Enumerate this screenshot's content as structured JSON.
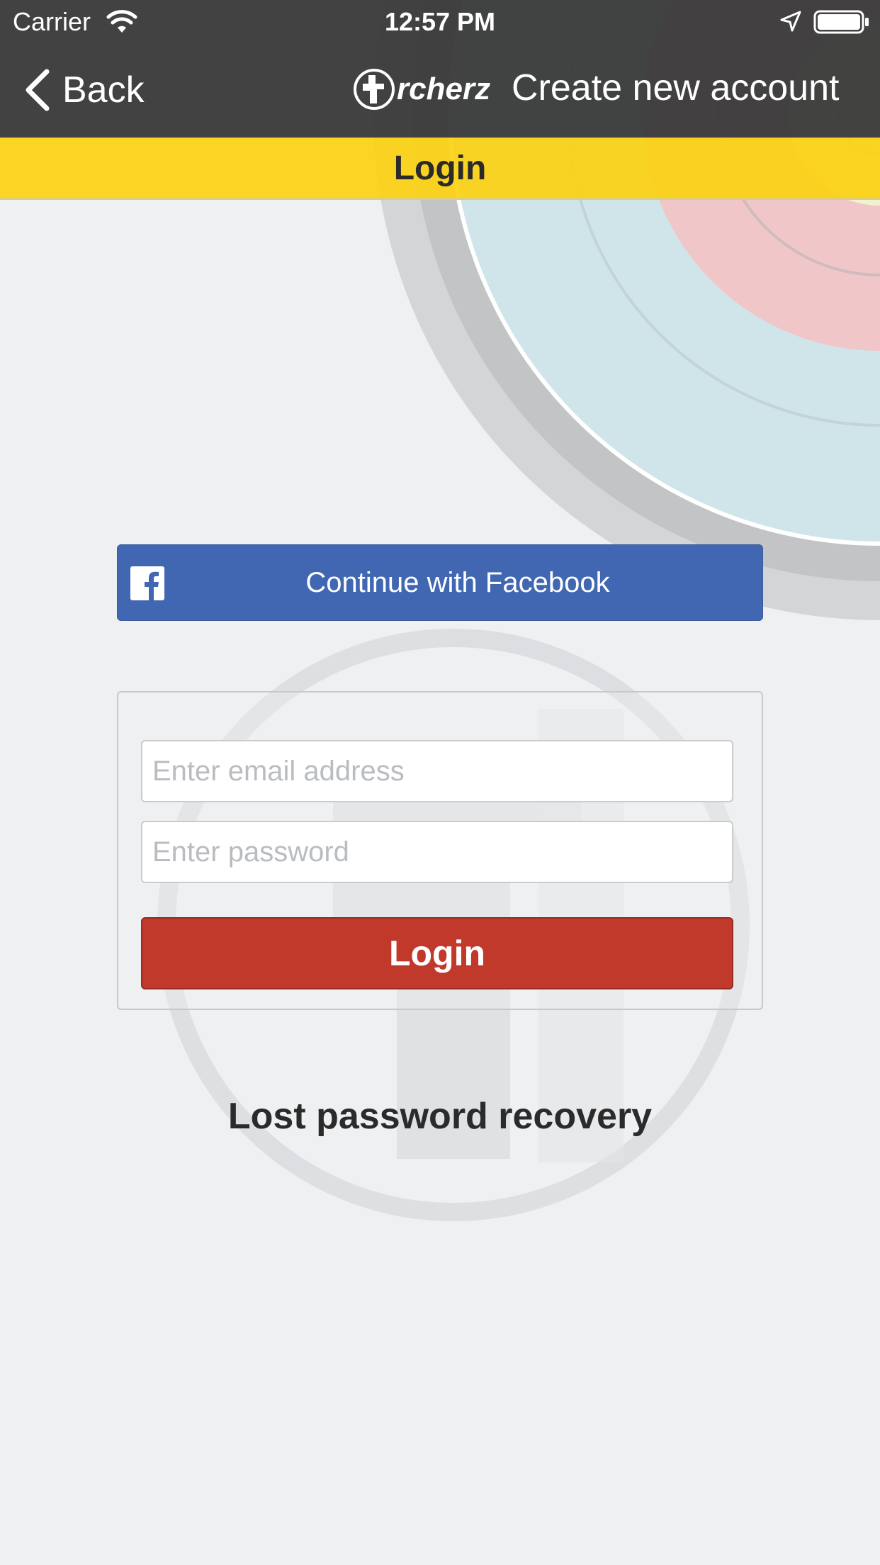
{
  "status_bar": {
    "carrier": "Carrier",
    "time": "12:57 PM",
    "icons": [
      "wifi-icon",
      "location-icon",
      "battery-icon"
    ]
  },
  "nav": {
    "back_label": "Back",
    "logo_text": "rcherz",
    "create_account_label": "Create new account"
  },
  "title_bar": {
    "title": "Login"
  },
  "facebook": {
    "label": "Continue with Facebook",
    "icon": "facebook-icon"
  },
  "login_form": {
    "email_placeholder": "Enter email address",
    "email_value": "",
    "password_placeholder": "Enter password",
    "password_value": "",
    "submit_label": "Login"
  },
  "lost_password_label": "Lost password recovery",
  "colors": {
    "nav_background": "#3c3c3c",
    "title_bar": "#fcd214",
    "facebook_blue": "#4267b2",
    "login_red": "#c0392b",
    "page_background": "#eef0f2"
  }
}
